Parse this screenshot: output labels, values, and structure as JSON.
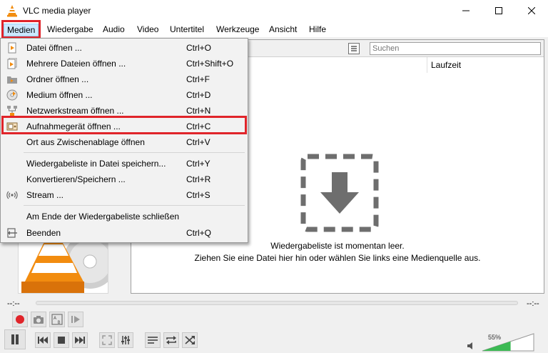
{
  "window": {
    "title": "VLC media player"
  },
  "menubar": {
    "items": [
      {
        "label": "Medien"
      },
      {
        "label": "Wiedergabe"
      },
      {
        "label": "Audio"
      },
      {
        "label": "Video"
      },
      {
        "label": "Untertitel"
      },
      {
        "label": "Werkzeuge"
      },
      {
        "label": "Ansicht"
      },
      {
        "label": "Hilfe"
      }
    ]
  },
  "media_menu": {
    "items": [
      {
        "label": "Datei öffnen ...",
        "shortcut": "Ctrl+O",
        "icon": "file-play-icon"
      },
      {
        "label": "Mehrere Dateien öffnen ...",
        "shortcut": "Ctrl+Shift+O",
        "icon": "files-play-icon"
      },
      {
        "label": "Ordner öffnen ...",
        "shortcut": "Ctrl+F",
        "icon": "folder-icon"
      },
      {
        "label": "Medium öffnen ...",
        "shortcut": "Ctrl+D",
        "icon": "disc-icon"
      },
      {
        "label": "Netzwerkstream öffnen ...",
        "shortcut": "Ctrl+N",
        "icon": "network-icon"
      },
      {
        "label": "Aufnahmegerät öffnen ...",
        "shortcut": "Ctrl+C",
        "icon": "capture-device-icon"
      },
      {
        "label": "Ort aus Zwischenablage öffnen",
        "shortcut": "Ctrl+V",
        "icon": ""
      },
      {
        "label": "Wiedergabeliste in Datei speichern...",
        "shortcut": "Ctrl+Y",
        "icon": ""
      },
      {
        "label": "Konvertieren/Speichern ...",
        "shortcut": "Ctrl+R",
        "icon": ""
      },
      {
        "label": "Stream ...",
        "shortcut": "Ctrl+S",
        "icon": "stream-icon"
      },
      {
        "label": "Am Ende der Wiedergabeliste schließen",
        "shortcut": "",
        "icon": ""
      },
      {
        "label": "Beenden",
        "shortcut": "Ctrl+Q",
        "icon": "exit-icon"
      }
    ]
  },
  "playlist": {
    "search_placeholder": "Suchen",
    "column_duration": "Laufzeit",
    "empty_line1": "Wiedergabeliste ist momentan leer.",
    "empty_line2": "Ziehen Sie eine Datei hier hin oder wählen Sie links eine Medienquelle aus."
  },
  "player": {
    "time_elapsed": "--:--",
    "time_total": "--:--",
    "volume_label": "55%",
    "volume_level": 0.55
  },
  "colors": {
    "highlight_red": "#e0242a",
    "vlc_orange": "#f28c0f",
    "record_red": "#e0242a",
    "volume_green": "#3cba54"
  }
}
